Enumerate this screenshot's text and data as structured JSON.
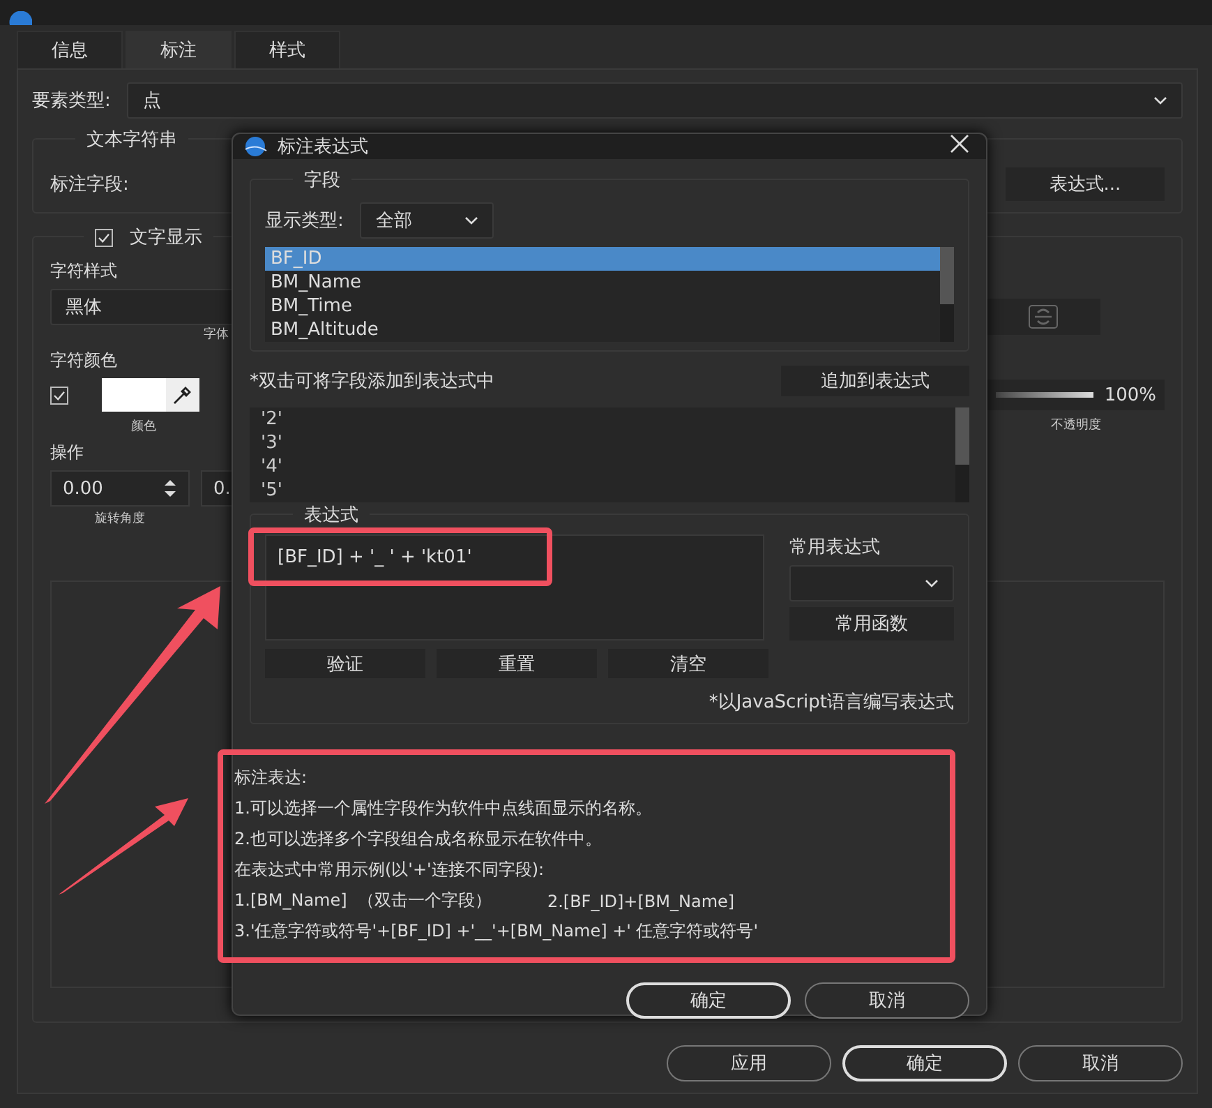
{
  "tabs": [
    {
      "label": "信息",
      "selected": false
    },
    {
      "label": "标注",
      "selected": true
    },
    {
      "label": "样式",
      "selected": false
    }
  ],
  "feature_type": {
    "label": "要素类型:",
    "value": "点"
  },
  "text_string": {
    "title": "文本字符串",
    "field_label": "标注字段:",
    "expression_button": "表达式..."
  },
  "text_display": {
    "label": "文字显示",
    "checked": true,
    "char_style_label": "字符样式",
    "font": "黑体",
    "font_caption": "字体",
    "char_color_label": "字符颜色",
    "color_checked": true,
    "color_caption": "颜色",
    "opacity": {
      "level": 1,
      "reading": "100%",
      "caption": "不透明度"
    },
    "ops_label": "操作",
    "rotation": {
      "value": "0.00",
      "caption": "旋转角度"
    },
    "second_value": "0."
  },
  "footer_buttons": [
    {
      "label": "应用",
      "primary": false
    },
    {
      "label": "确定",
      "primary": true
    },
    {
      "label": "取消",
      "primary": false
    }
  ],
  "dialog": {
    "title": "标注表达式",
    "fields": {
      "title": "字段",
      "display_type_label": "显示类型:",
      "display_type": "全部",
      "items": [
        {
          "label": "BF_ID",
          "selected": true
        },
        {
          "label": "BM_Name",
          "selected": false
        },
        {
          "label": "BM_Time",
          "selected": false
        },
        {
          "label": "BM_Altitude",
          "selected": false
        }
      ]
    },
    "hint": "*双击可将字段添加到表达式中",
    "append_button": "追加到表达式",
    "values": [
      "'2'",
      "'3'",
      "'4'",
      "'5'"
    ],
    "expression": {
      "title": "表达式",
      "value": "[BF_ID] + '_ ' + 'kt01'",
      "common_label": "常用表达式",
      "functions_button": "常用函数",
      "buttons": [
        "验证",
        "重置",
        "清空"
      ],
      "note": "*以JavaScript语言编写表达式"
    },
    "help": [
      "标注表达:",
      "1.可以选择一个属性字段作为软件中点线面显示的名称。",
      "2.也可以选择多个字段组合成名称显示在软件中。",
      "在表达式中常用示例(以'+'连接不同字段):"
    ],
    "help_examples": [
      "1.[BM_Name]  （双击一个字段）",
      "2.[BF_ID]+[BM_Name]"
    ],
    "help_last": "3.'任意字符或符号'+[BF_ID] +'__'+[BM_Name] +' 任意字符或符号'",
    "buttons": [
      {
        "label": "确定",
        "primary": true
      },
      {
        "label": "取消",
        "primary": false
      }
    ]
  }
}
